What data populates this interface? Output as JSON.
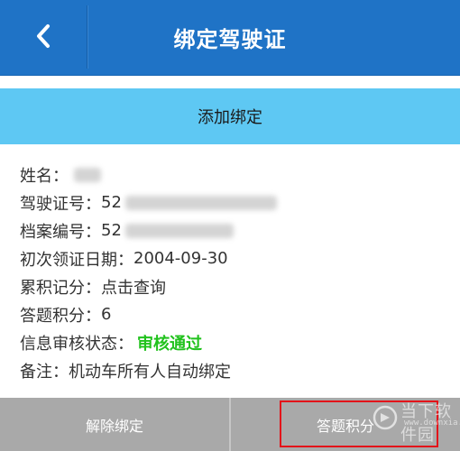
{
  "header": {
    "title": "绑定驾驶证",
    "back_icon": "chevron-left-icon"
  },
  "add_binding": {
    "label": "添加绑定"
  },
  "info": {
    "name_label": "姓名：",
    "license_label": "驾驶证号：",
    "license_prefix": "52",
    "file_label": "档案编号：",
    "file_prefix": "52",
    "first_issue_label": "初次领证日期：",
    "first_issue_value": "2004-09-30",
    "points_label": "累积记分：",
    "points_value": "点击查询",
    "quiz_label": "答题积分：",
    "quiz_value": "6",
    "review_label": "信息审核状态：",
    "review_value": "审核通过",
    "note_label": "备注：",
    "note_value": "机动车所有人自动绑定"
  },
  "actions": {
    "unbind_label": "解除绑定",
    "quiz_points_label": "答题积分"
  },
  "watermark": {
    "text": "当下软件园",
    "sub": "www.downxia.com"
  },
  "colors": {
    "header": "#1f73c6",
    "add_bar": "#5ec8f3",
    "status_ok": "#21c21d",
    "highlight": "#e3131a"
  }
}
